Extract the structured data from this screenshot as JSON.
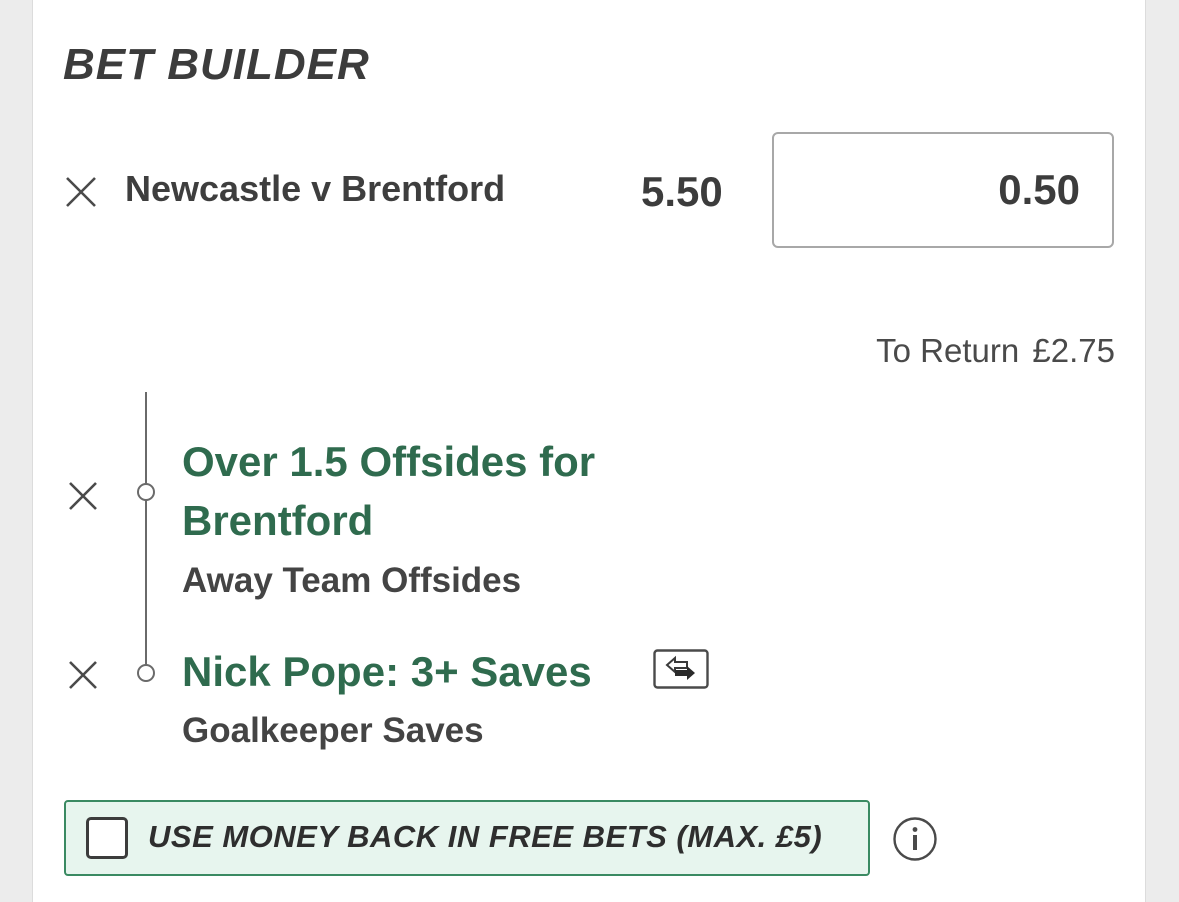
{
  "bet_builder": {
    "title": "BET BUILDER",
    "event_name": "Newcastle v Brentford",
    "odds": "5.50",
    "stake_value": "0.50",
    "to_return_label": "To Return",
    "to_return_value": "£2.75",
    "selections": [
      {
        "title_line1": "Over 1.5 Offsides for",
        "title_line2": "Brentford",
        "market": "Away Team Offsides"
      },
      {
        "title_line1": "Nick Pope: 3+ Saves",
        "market": "Goalkeeper Saves",
        "icon": "swap-icon"
      }
    ],
    "money_back": {
      "label": "USE MONEY BACK IN FREE BETS (MAX. £5)",
      "checked": false
    },
    "icons": {
      "remove": "close-icon",
      "info": "info-icon"
    },
    "colors": {
      "selection_green": "#2f6b4e",
      "promo_border": "#3a8a62",
      "promo_bg": "#e7f5ee"
    }
  }
}
